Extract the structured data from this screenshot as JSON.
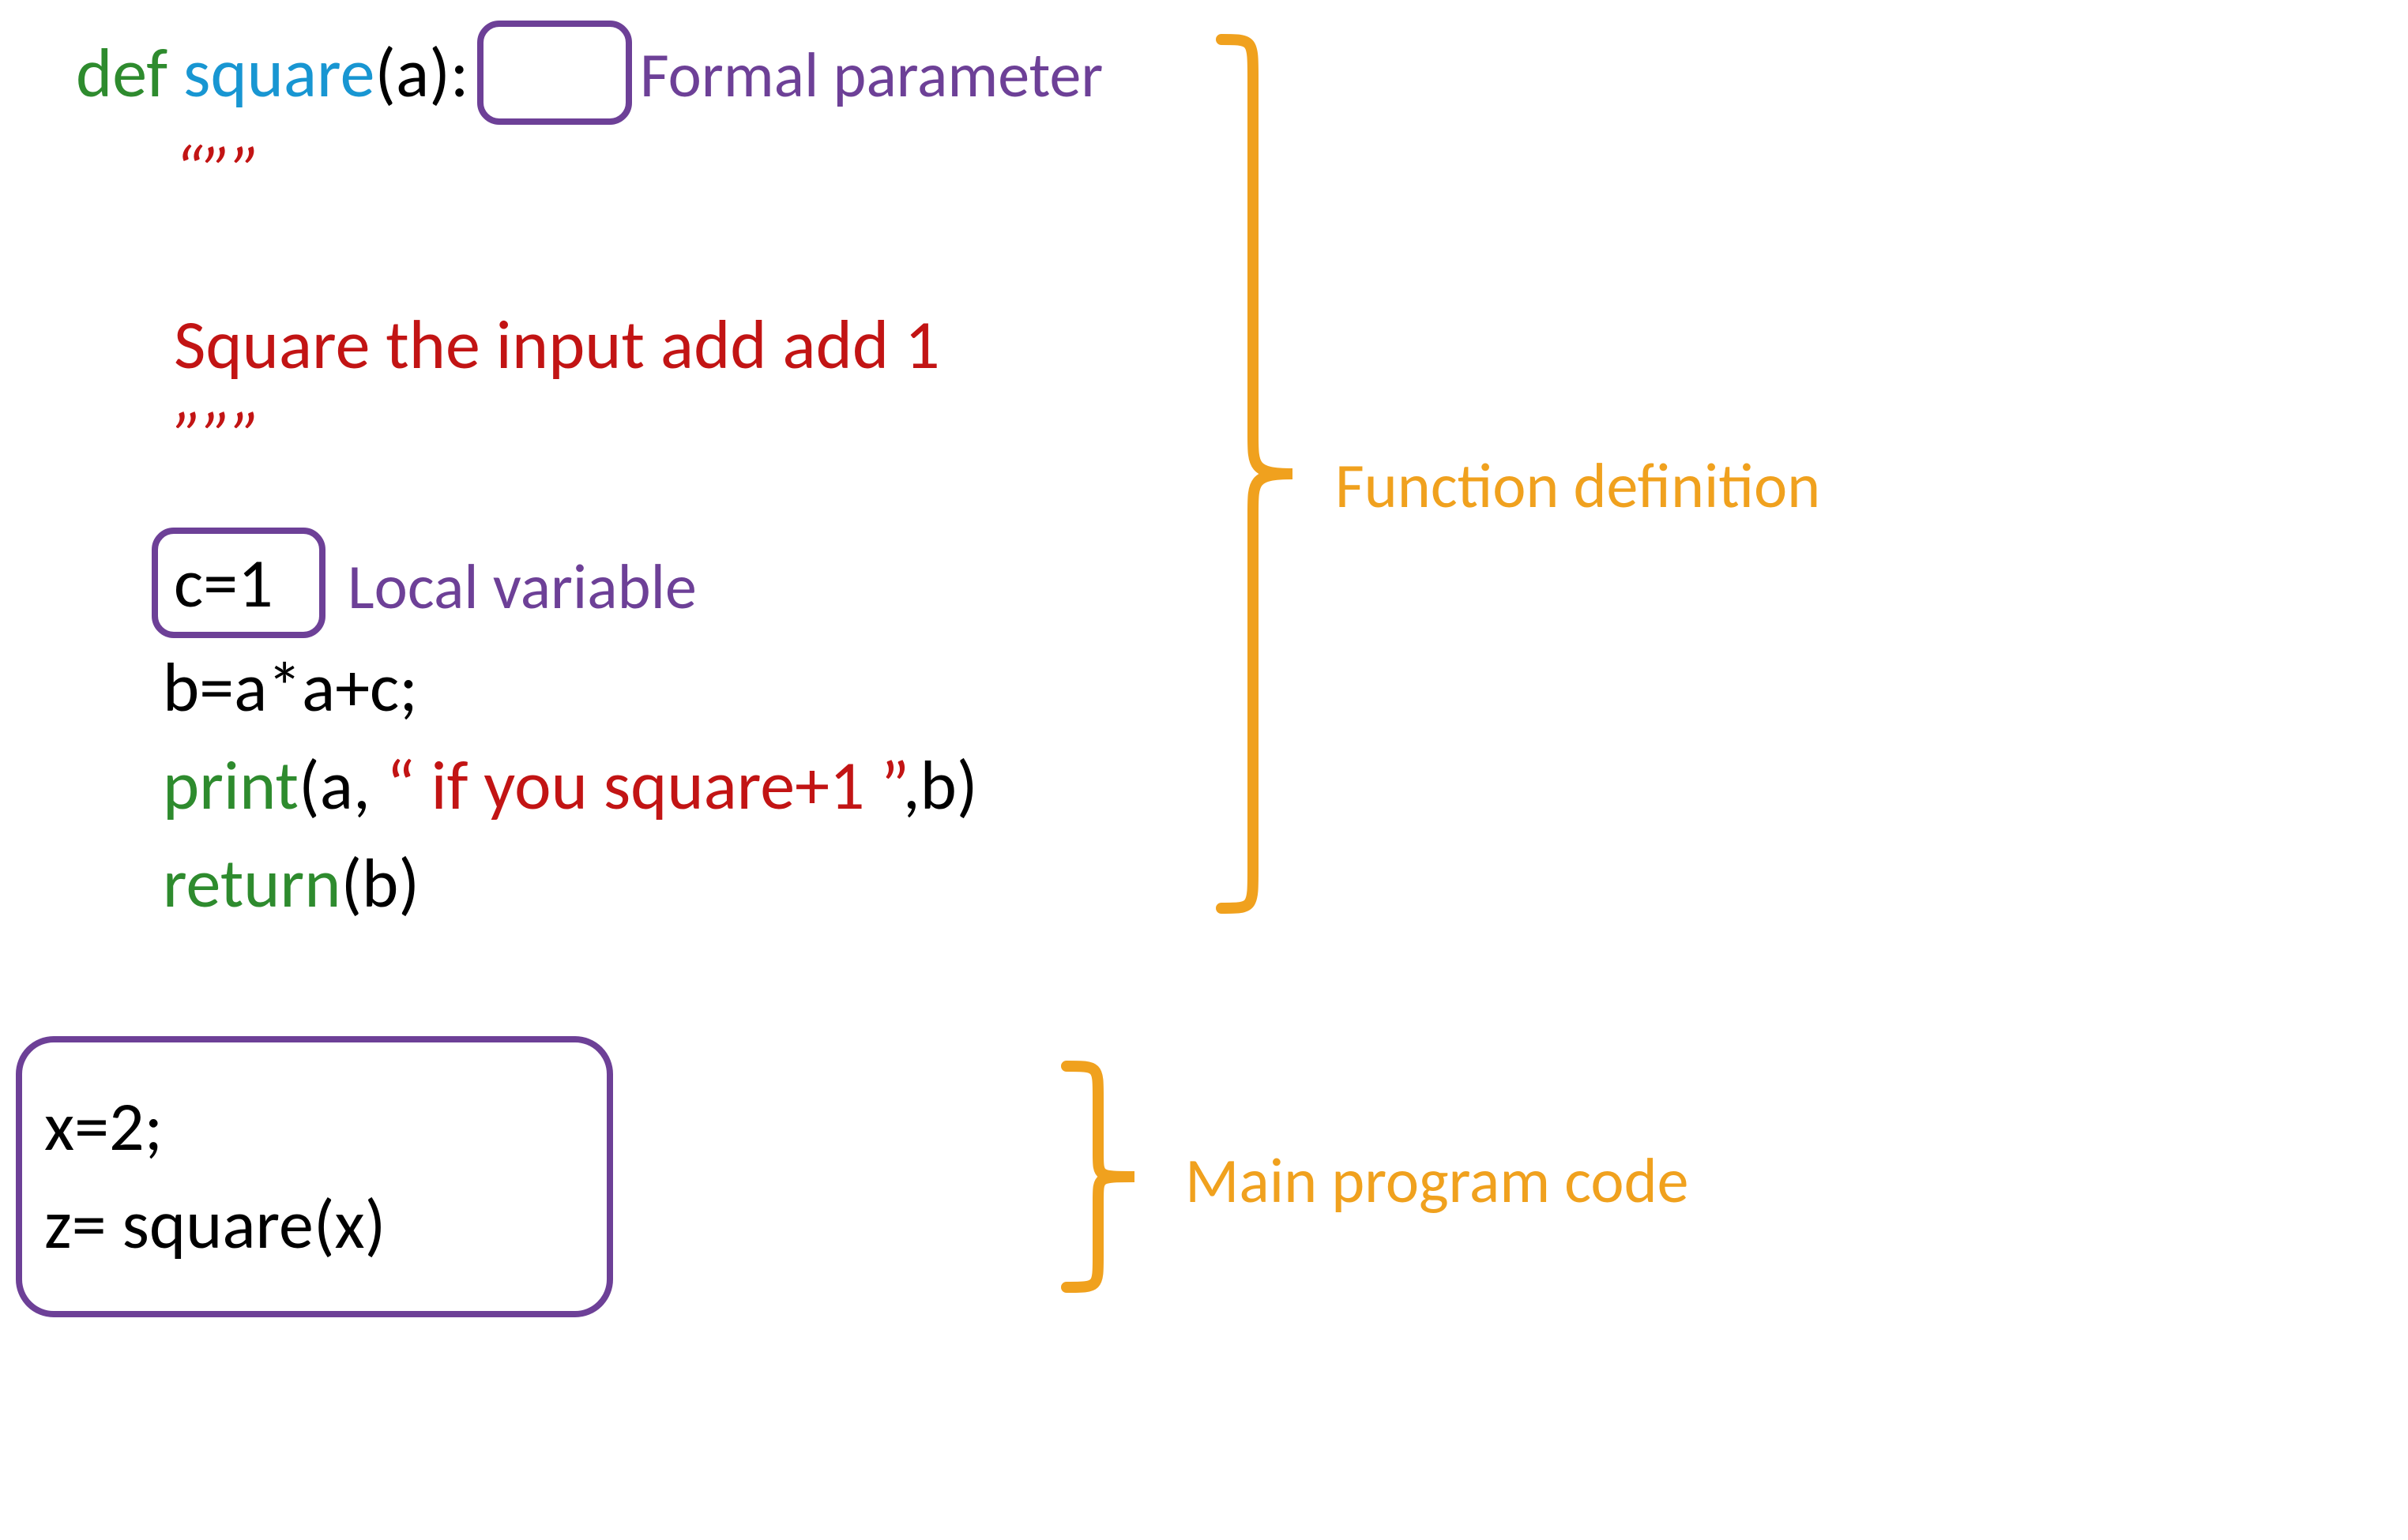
{
  "code": {
    "def_kw": "def",
    "func_name": " square",
    "param_open": "(a)",
    "colon": ":",
    "doc_open": "“””",
    "doc_body": "Square the input add add 1",
    "doc_close": "”””",
    "local_assign": "c=1",
    "body_line": "b=a*a+c;",
    "print_kw": "print",
    "print_rest1": "(a, ",
    "print_str": "“ if you square+1  ”",
    "print_rest2": ",b)",
    "return_kw": "return",
    "return_rest": "(b)",
    "main1": "x=2;",
    "main2": "z= square(x)"
  },
  "annotations": {
    "formal_param": "Formal parameter",
    "local_var": "Local variable",
    "func_def": "Function definition",
    "main_prog": "Main program code"
  }
}
